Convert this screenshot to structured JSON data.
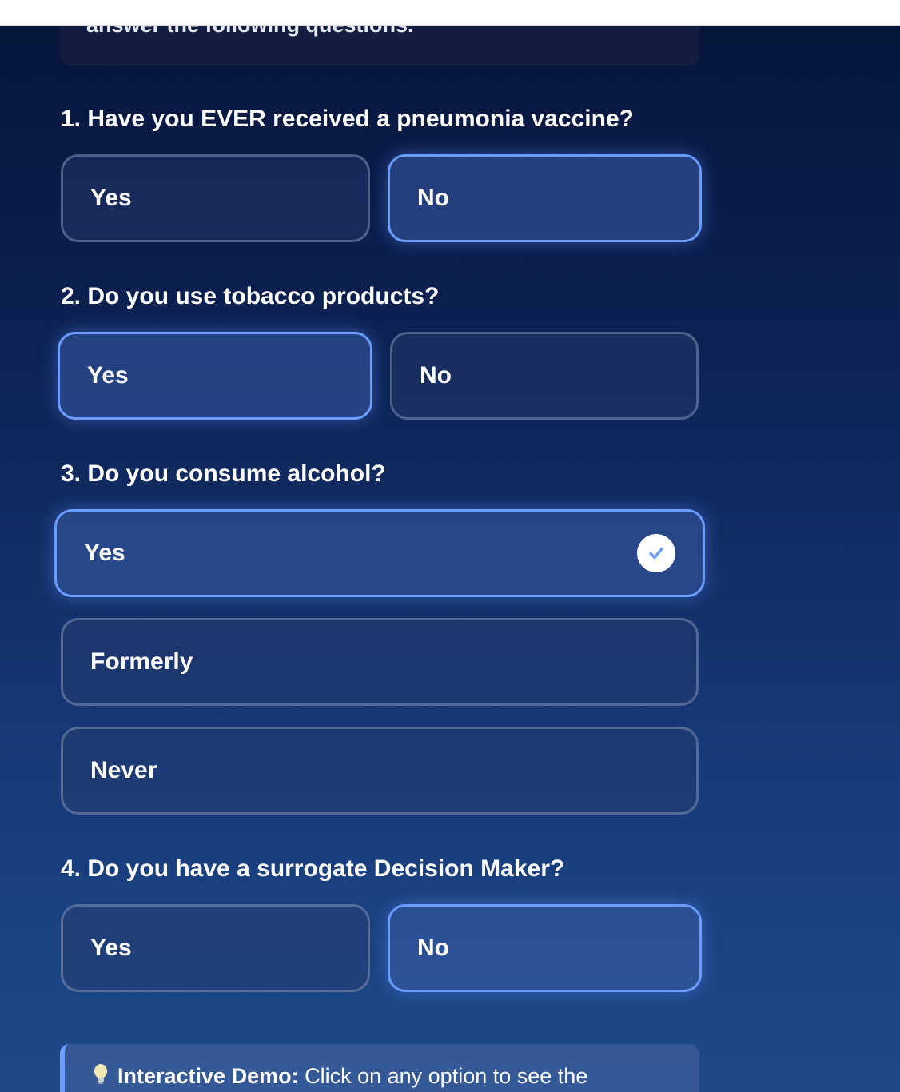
{
  "intro": {
    "text": "answer the following questions."
  },
  "questions": [
    {
      "label": "1. Have you EVER received a pneumonia vaccine?",
      "options": [
        {
          "label": "Yes",
          "selected": false
        },
        {
          "label": "No",
          "selected": true
        }
      ]
    },
    {
      "label": "2. Do you use tobacco products?",
      "options": [
        {
          "label": "Yes",
          "selected": true
        },
        {
          "label": "No",
          "selected": false
        }
      ]
    },
    {
      "label": "3. Do you consume alcohol?",
      "options": [
        {
          "label": "Yes",
          "selected": true
        },
        {
          "label": "Formerly",
          "selected": false
        },
        {
          "label": "Never",
          "selected": false
        }
      ]
    },
    {
      "label": "4. Do you have a surrogate Decision Maker?",
      "options": [
        {
          "label": "Yes",
          "selected": false
        },
        {
          "label": "No",
          "selected": true
        }
      ]
    }
  ],
  "demo": {
    "title": "Interactive Demo:",
    "text": "Click on any option to see the"
  },
  "colors": {
    "accent": "#6d9cff",
    "check_fill": "#ffffff"
  },
  "icons": {
    "check": "check-icon",
    "bulb": "lightbulb-icon"
  }
}
